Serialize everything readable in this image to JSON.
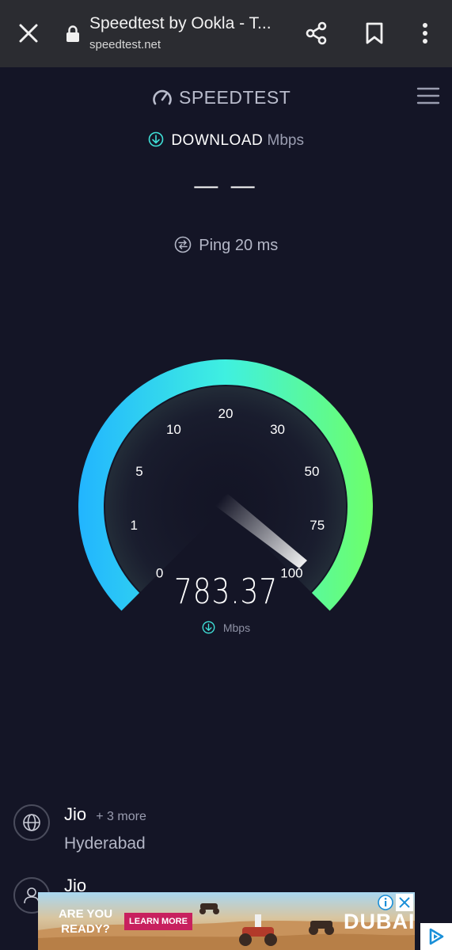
{
  "browser": {
    "title": "Speedtest by Ookla - T...",
    "url": "speedtest.net"
  },
  "header": {
    "logo_text": "SPEEDTEST"
  },
  "download": {
    "label": "DOWNLOAD",
    "unit": "Mbps",
    "value": "— —"
  },
  "ping": {
    "text": "Ping 20 ms"
  },
  "gauge": {
    "ticks": [
      "0",
      "1",
      "5",
      "10",
      "20",
      "30",
      "50",
      "75",
      "100"
    ],
    "current_value": "783.37",
    "unit": "Mbps",
    "colors": {
      "start": "#22b5ff",
      "mid": "#3ff0e0",
      "end": "#6dff6a"
    }
  },
  "server": {
    "isp": "Jio",
    "isp_more": "+ 3 more",
    "location": "Hyderabad",
    "user_provider": "Jio"
  },
  "ad": {
    "headline": "ARE YOU READY?",
    "cta": "LEARN MORE",
    "brand": "DUBAI"
  },
  "icons": {
    "close": "close-icon",
    "lock": "lock-icon",
    "share": "share-icon",
    "bookmark": "bookmark-icon",
    "more": "more-vertical-icon",
    "menu": "hamburger-menu-icon",
    "download": "download-arrow-icon",
    "ping": "ping-icon",
    "globe": "globe-icon",
    "user": "user-icon"
  }
}
